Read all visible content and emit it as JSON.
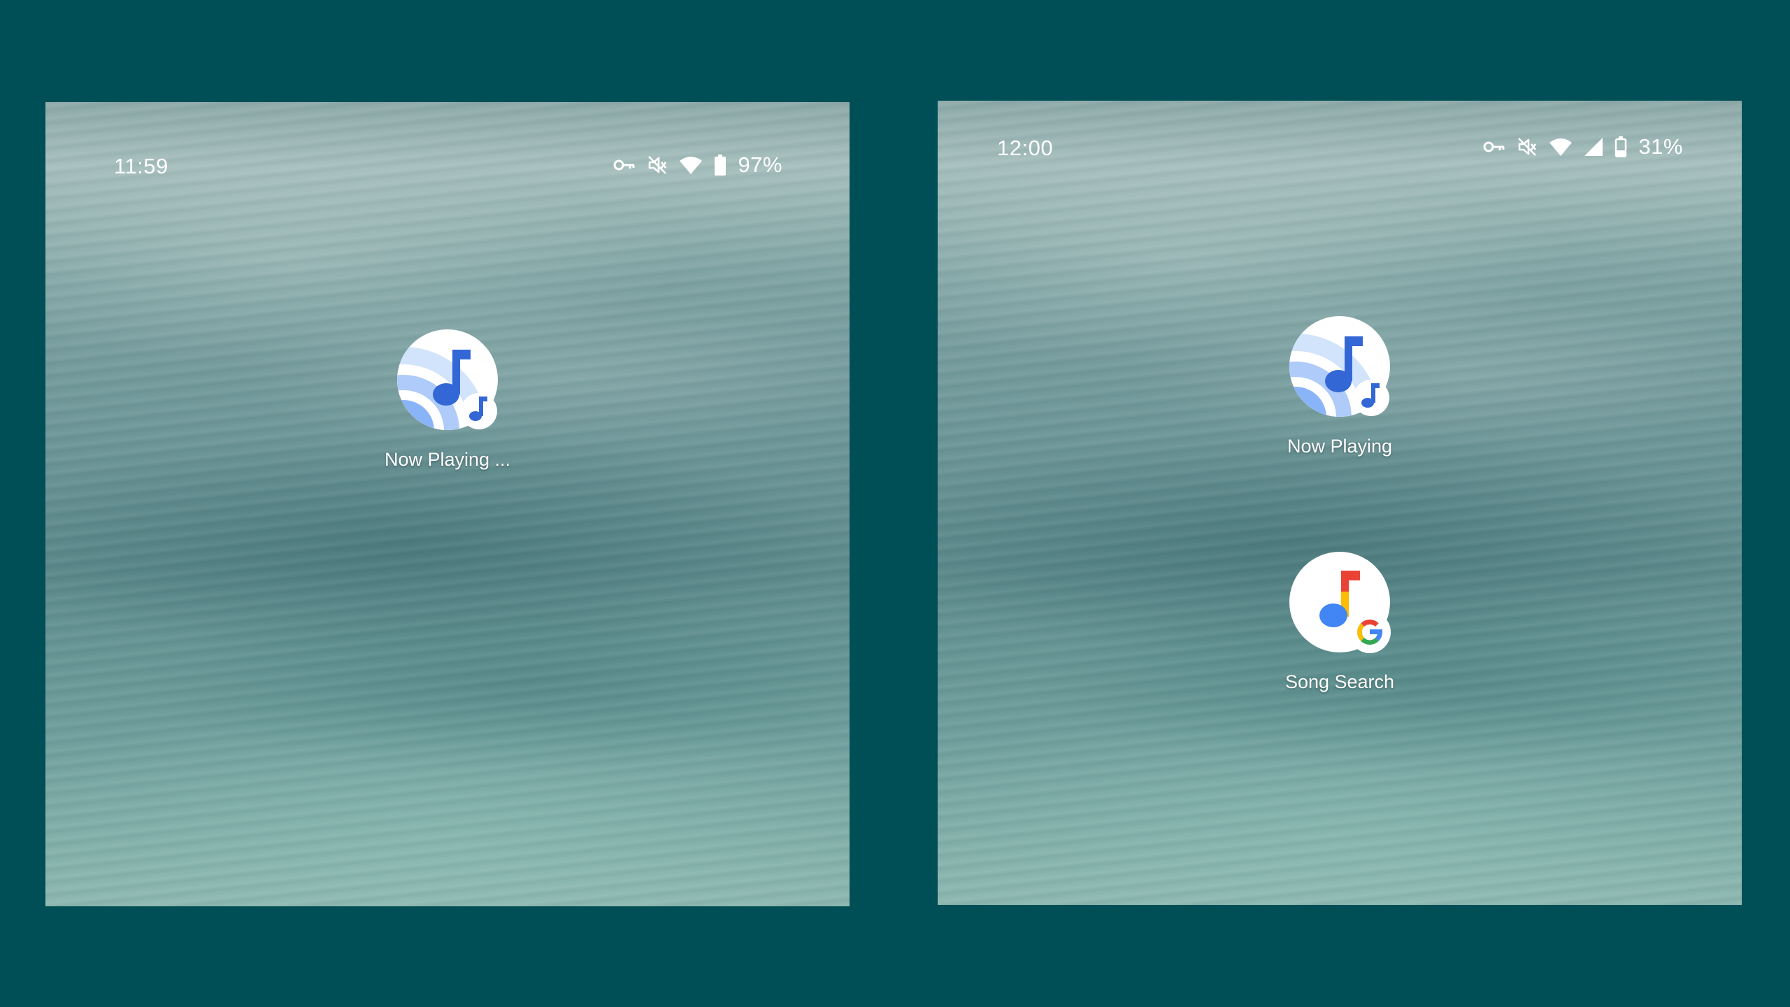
{
  "background_color": "#014f56",
  "screens": [
    {
      "status_bar": {
        "time": "11:59",
        "icons": [
          "vpn-key-icon",
          "mute-icon",
          "wifi-icon",
          "battery-icon"
        ],
        "battery": "97%"
      },
      "apps": [
        {
          "label": "Now Playing ...",
          "icon": "now-playing-icon"
        }
      ]
    },
    {
      "status_bar": {
        "time": "12:00",
        "icons": [
          "vpn-key-icon",
          "mute-icon",
          "wifi-icon",
          "cell-signal-icon",
          "battery-icon"
        ],
        "battery": "31%"
      },
      "apps": [
        {
          "label": "Now Playing",
          "icon": "now-playing-icon"
        },
        {
          "label": "Song Search",
          "icon": "song-search-icon"
        }
      ]
    }
  ]
}
